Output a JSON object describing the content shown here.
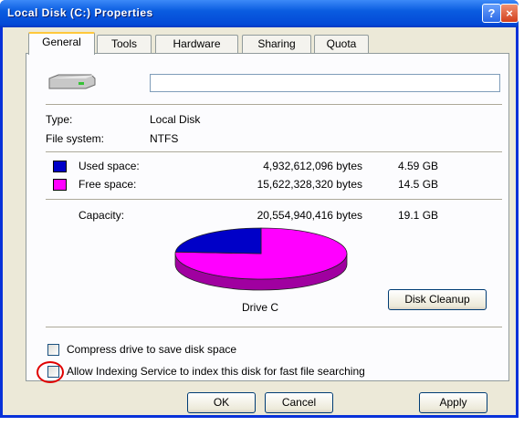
{
  "window": {
    "title": "Local Disk (C:) Properties",
    "help_glyph": "?",
    "close_glyph": "×"
  },
  "tabs": [
    {
      "label": "General",
      "active": true
    },
    {
      "label": "Tools"
    },
    {
      "label": "Hardware"
    },
    {
      "label": "Sharing"
    },
    {
      "label": "Quota"
    }
  ],
  "general": {
    "drive_icon": "hard-drive-icon",
    "label_value": "",
    "type_label": "Type:",
    "type_value": "Local Disk",
    "fs_label": "File system:",
    "fs_value": "NTFS",
    "used": {
      "label": "Used space:",
      "bytes": "4,932,612,096 bytes",
      "size": "4.59 GB",
      "color": "#0000c8"
    },
    "free": {
      "label": "Free space:",
      "bytes": "15,622,328,320 bytes",
      "size": "14.5 GB",
      "color": "#ff00ff"
    },
    "capacity": {
      "label": "Capacity:",
      "bytes": "20,554,940,416 bytes",
      "size": "19.1 GB"
    },
    "used_fraction": 0.24,
    "drive_label": "Drive C",
    "cleanup_button": "Disk Cleanup",
    "compress_label": "Compress drive to save disk space",
    "index_label": "Allow Indexing Service to index this disk for fast file searching"
  },
  "buttons": {
    "ok": "OK",
    "cancel": "Cancel",
    "apply": "Apply"
  }
}
